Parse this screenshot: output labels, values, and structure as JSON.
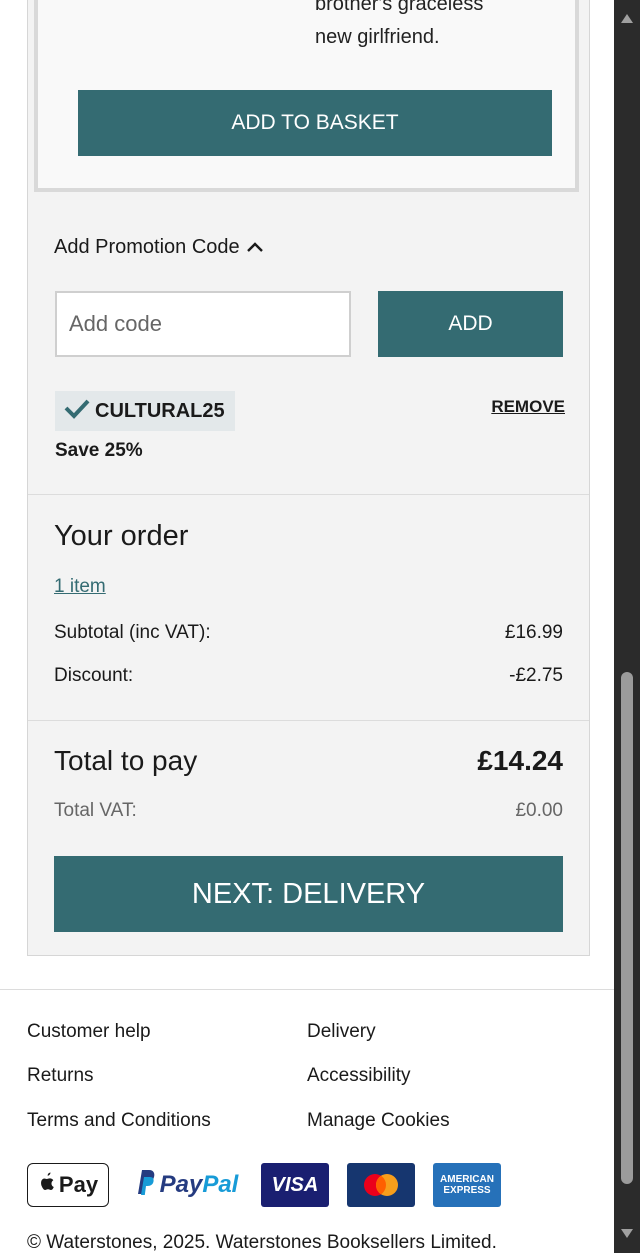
{
  "upsell": {
    "description_lines": [
      "brother's graceless",
      "new girlfriend."
    ],
    "add_to_basket_label": "ADD TO BASKET"
  },
  "promo": {
    "toggle_label": "Add Promotion Code",
    "input_value": "",
    "input_placeholder": "Add code",
    "add_label": "ADD",
    "applied_code": "CULTURAL25",
    "remove_label": "REMOVE",
    "saving_text": "Save 25%"
  },
  "order": {
    "title": "Your order",
    "items_link": "1 item",
    "subtotal_label": "Subtotal (inc VAT):",
    "subtotal_value": "£16.99",
    "discount_label": "Discount:",
    "discount_value": "-£2.75",
    "total_label": "Total to pay",
    "total_value": "£14.24",
    "vat_label": "Total VAT:",
    "vat_value": "£0.00",
    "next_label": "NEXT: DELIVERY"
  },
  "footer": {
    "links": {
      "customer_help": "Customer help",
      "delivery": "Delivery",
      "returns": "Returns",
      "accessibility": "Accessibility",
      "terms": "Terms and Conditions",
      "manage_cookies": "Manage Cookies"
    },
    "payments": {
      "apple_pay": "Pay",
      "paypal_p": "Pay",
      "paypal_pal": "Pal",
      "visa": "VISA",
      "amex_top": "AMERICAN",
      "amex_bottom": "EXPRESS"
    },
    "copyright": "© Waterstones, 2025. Waterstones Booksellers Limited."
  },
  "colors": {
    "accent": "#346b72",
    "panel_bg": "#f3f3f3",
    "chip_bg": "#e3e8ea"
  },
  "icons": {
    "promo_toggle": "chevron-up-icon",
    "applied_code": "checkmark-icon",
    "apple": "apple-icon",
    "paypal": "paypal-icon"
  }
}
